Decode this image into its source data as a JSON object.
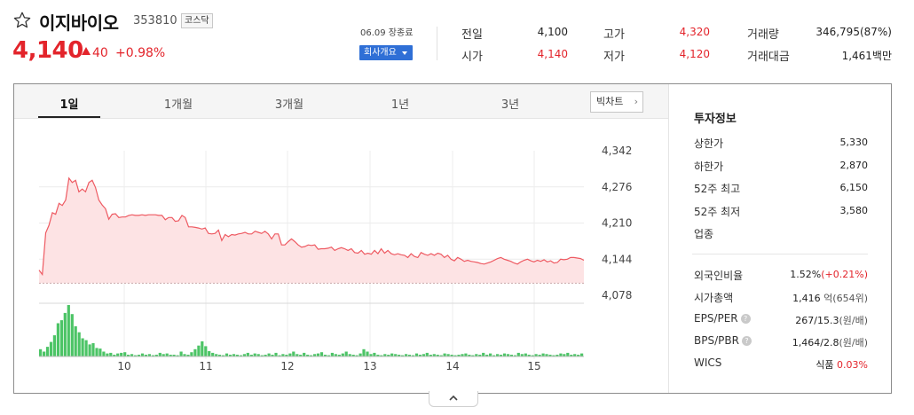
{
  "stock": {
    "name": "이지바이오",
    "code": "353810",
    "market": "코스닥",
    "price": "4,140",
    "change": "40",
    "change_rate": "+0.98%",
    "direction": "up"
  },
  "session": {
    "date_label": "06.09 장종료",
    "company_button": "회사개요"
  },
  "quote": {
    "prev_close_label": "전일",
    "prev_close": "4,100",
    "open_label": "시가",
    "open": "4,140",
    "high_label": "고가",
    "high": "4,320",
    "low_label": "저가",
    "low": "4,120",
    "volume_label": "거래량",
    "volume": "346,795(87%)",
    "value_label": "거래대금",
    "value": "1,461백만"
  },
  "tabs": [
    "1일",
    "1개월",
    "3개월",
    "1년",
    "3년"
  ],
  "active_tab": "1일",
  "big_chart_button": "빅차트",
  "investment": {
    "title": "투자정보",
    "upper_limit_label": "상한가",
    "upper_limit": "5,330",
    "lower_limit_label": "하한가",
    "lower_limit": "2,870",
    "week52_high_label": "52주 최고",
    "week52_high": "6,150",
    "week52_low_label": "52주 최저",
    "week52_low": "3,580",
    "sector_label": "업종",
    "foreign_label": "외국인비율",
    "foreign_ratio": "1.52%",
    "foreign_change": "(+0.21%)",
    "market_cap_label": "시가총액",
    "market_cap": "1,416",
    "market_cap_suffix": "억(654위)",
    "eps_per_label": "EPS/PER",
    "eps_per": "267/15.3",
    "eps_per_suffix": "(원/배)",
    "bps_pbr_label": "BPS/PBR",
    "bps_pbr": "1,464/2.8",
    "bps_pbr_suffix": "(원/배)",
    "wics_label": "WICS",
    "wics_sector": "식품",
    "wics_change": "0.03%"
  },
  "colors": {
    "up": "#e3242b",
    "down": "#2f5ec4",
    "line": "#ee5a62",
    "area_fill": "#fde3e4",
    "volume_bar": "#4cc466",
    "button_blue": "#2f6fd6"
  },
  "icons": [
    "star-icon",
    "caret-down-icon",
    "chevron-right-icon",
    "chevron-up-icon",
    "help-icon"
  ],
  "chart_data": {
    "type": "area",
    "title": "",
    "x_ticks": [
      "10",
      "11",
      "12",
      "13",
      "14",
      "15"
    ],
    "y_ticks": [
      4342,
      4276,
      4210,
      4144,
      4078
    ],
    "ylim": [
      4078,
      4342
    ],
    "reference_price": 4100,
    "grid": true,
    "price": [
      4124,
      4116,
      4192,
      4206,
      4229,
      4226,
      4246,
      4242,
      4252,
      4292,
      4284,
      4288,
      4267,
      4272,
      4267,
      4284,
      4288,
      4275,
      4252,
      4243,
      4236,
      4217,
      4226,
      4227,
      4220,
      4221,
      4221,
      4224,
      4225,
      4224,
      4224,
      4225,
      4224,
      4225,
      4225,
      4225,
      4224,
      4224,
      4216,
      4220,
      4220,
      4213,
      4214,
      4224,
      4220,
      4203,
      4203,
      4202,
      4201,
      4199,
      4201,
      4191,
      4190,
      4191,
      4197,
      4178,
      4189,
      4185,
      4189,
      4188,
      4190,
      4191,
      4193,
      4190,
      4190,
      4195,
      4193,
      4191,
      4195,
      4190,
      4181,
      4190,
      4190,
      4170,
      4170,
      4176,
      4181,
      4176,
      4170,
      4166,
      4167,
      4170,
      4169,
      4170,
      4162,
      4163,
      4163,
      4164,
      4166,
      4160,
      4163,
      4165,
      4163,
      4160,
      4163,
      4156,
      4155,
      4160,
      4153,
      4155,
      4153,
      4160,
      4154,
      4163,
      4155,
      4160,
      4154,
      4152,
      4154,
      4152,
      4151,
      4147,
      4154,
      4149,
      4147,
      4156,
      4153,
      4151,
      4154,
      4151,
      4155,
      4153,
      4147,
      4151,
      4144,
      4141,
      4147,
      4144,
      4140,
      4142,
      4140,
      4139,
      4138,
      4136,
      4135,
      4137,
      4139,
      4142,
      4145,
      4147,
      4144,
      4142,
      4140,
      4137,
      4135,
      4139,
      4142,
      4144,
      4141,
      4139,
      4142,
      4140,
      4143,
      4139,
      4141,
      4137,
      4138,
      4144,
      4143,
      4144,
      4147,
      4147,
      4146,
      4145,
      4142
    ],
    "volume": [
      12,
      8,
      16,
      24,
      35,
      55,
      60,
      72,
      85,
      70,
      50,
      40,
      30,
      27,
      20,
      22,
      14,
      13,
      8,
      5,
      6,
      3,
      5,
      6,
      7,
      3,
      4,
      2,
      3,
      5,
      3,
      4,
      2,
      3,
      6,
      4,
      5,
      3,
      3,
      2,
      8,
      4,
      3,
      7,
      12,
      18,
      25,
      17,
      9,
      6,
      4,
      3,
      2,
      5,
      3,
      4,
      3,
      2,
      4,
      6,
      3,
      5,
      4,
      2,
      3,
      5,
      3,
      6,
      2,
      4,
      3,
      5,
      8,
      4,
      3,
      6,
      3,
      2,
      4,
      5,
      7,
      3,
      2,
      6,
      4,
      3,
      5,
      8,
      4,
      3,
      2,
      5,
      12,
      8,
      4,
      6,
      3,
      2,
      4,
      3,
      5,
      4,
      3,
      2,
      4,
      3,
      2,
      5,
      3,
      4,
      6,
      3,
      4,
      3,
      2,
      5,
      4,
      3,
      2,
      3,
      4,
      5,
      3,
      2,
      4,
      3,
      6,
      3,
      5,
      2,
      4,
      3,
      5,
      4,
      3,
      2,
      6,
      4,
      5,
      3,
      2,
      4,
      3,
      5,
      4,
      3,
      2,
      3,
      5,
      4,
      6,
      3,
      4,
      3,
      5
    ]
  }
}
